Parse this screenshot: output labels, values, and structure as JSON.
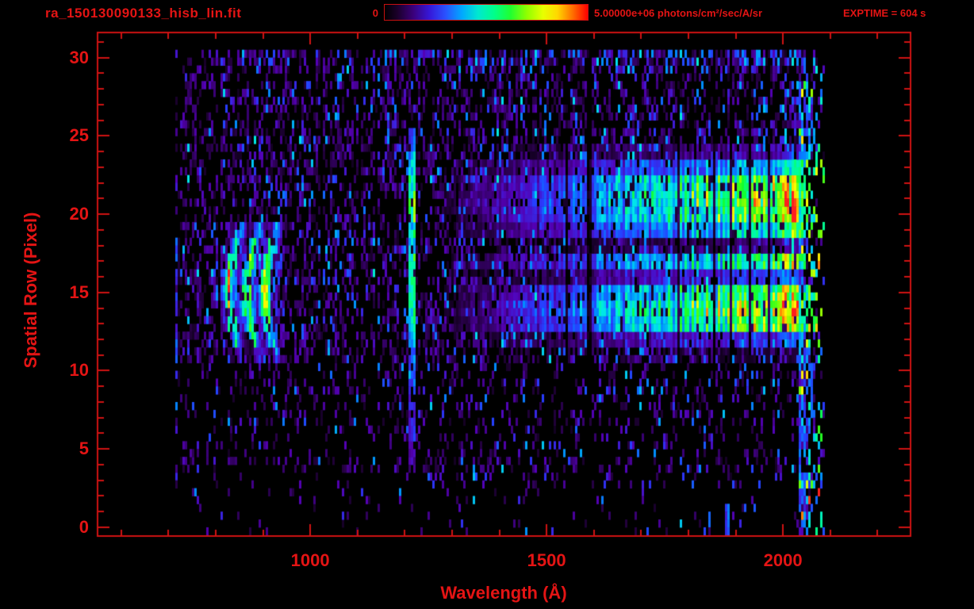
{
  "window": {
    "background": "#000000"
  },
  "header": {
    "title": "ra_150130090133_hisb_lin.fit",
    "exptime_label": "EXPTIME = 604 s"
  },
  "colors": {
    "accent_red": "#e41414",
    "axis_red": "#d01212",
    "colorbar_stops": [
      [
        0,
        "#000000"
      ],
      [
        6,
        "#1a0028"
      ],
      [
        14,
        "#3a007a"
      ],
      [
        22,
        "#3617d8"
      ],
      [
        30,
        "#2a52ff"
      ],
      [
        38,
        "#00a8ff"
      ],
      [
        46,
        "#00e8d0"
      ],
      [
        54,
        "#00ff8a"
      ],
      [
        62,
        "#20ff30"
      ],
      [
        70,
        "#90ff00"
      ],
      [
        78,
        "#e8ff00"
      ],
      [
        85,
        "#ffd800"
      ],
      [
        92,
        "#ff7700"
      ],
      [
        100,
        "#ff0000"
      ]
    ],
    "heatmap_stops": [
      [
        0.0,
        0,
        0,
        0
      ],
      [
        0.07,
        36,
        0,
        64
      ],
      [
        0.16,
        84,
        0,
        180
      ],
      [
        0.26,
        40,
        60,
        255
      ],
      [
        0.36,
        0,
        140,
        255
      ],
      [
        0.46,
        0,
        230,
        235
      ],
      [
        0.55,
        0,
        255,
        150
      ],
      [
        0.65,
        20,
        255,
        40
      ],
      [
        0.74,
        140,
        255,
        0
      ],
      [
        0.82,
        255,
        255,
        0
      ],
      [
        0.9,
        255,
        150,
        0
      ],
      [
        1.0,
        255,
        30,
        30
      ]
    ]
  },
  "chart_data": {
    "type": "heatmap",
    "title": "ra_150130090133_hisb_lin.fit",
    "xlabel": "Wavelength (Å)",
    "ylabel": "Spatial Row (Pixel)",
    "xlim": [
      550,
      2270
    ],
    "ylim": [
      -0.56,
      31.6
    ],
    "xticks": {
      "major": [
        {
          "value": 1000,
          "label": "1000"
        },
        {
          "value": 1500,
          "label": "1500"
        },
        {
          "value": 2000,
          "label": "2000"
        }
      ],
      "minor_step": 100
    },
    "yticks": {
      "major": [
        {
          "value": 0,
          "label": "0"
        },
        {
          "value": 5,
          "label": "5"
        },
        {
          "value": 10,
          "label": "10"
        },
        {
          "value": 15,
          "label": "15"
        },
        {
          "value": 20,
          "label": "20"
        },
        {
          "value": 25,
          "label": "25"
        },
        {
          "value": 30,
          "label": "30"
        }
      ],
      "minor_step": 1
    },
    "colorbar": {
      "min": 0,
      "max": 5000000,
      "min_label": "0",
      "max_label": "5.00000e+06 photons/cm²/sec/A/sr",
      "units": "photons/cm²/sec/A/sr"
    },
    "exposure": {
      "label": "EXPTIME = 604 s",
      "seconds": 604
    },
    "data_extent": {
      "wavelength_min": 715,
      "wavelength_max": 2085,
      "row_min": 0,
      "row_max": 30.5
    },
    "continuum": {
      "onset_wavelength": 1245,
      "mid_wavelength": 1650,
      "bright_wavelength": 2035
    },
    "row_continuum_profile": [
      0,
      0,
      0,
      0,
      0,
      0,
      0,
      0,
      0,
      0,
      0,
      0.06,
      0.3,
      0.85,
      0.95,
      0.8,
      0.32,
      0.72,
      0.14,
      0.62,
      0.85,
      0.92,
      0.85,
      0.5,
      0.18,
      0,
      0,
      0,
      0,
      0,
      0
    ],
    "noise_density_by_row": [
      0.05,
      0.06,
      0.07,
      0.12,
      0.3,
      0.22,
      0.22,
      0.26,
      0.22,
      0.28,
      0.24,
      0.5,
      0.55,
      0.5,
      0.45,
      0.5,
      0.5,
      0.5,
      0.55,
      0.5,
      0.45,
      0.45,
      0.5,
      0.55,
      0.55,
      0.5,
      0.4,
      0.45,
      0.4,
      0.45,
      0.55
    ],
    "blue_ramp_by_row": [
      0.5,
      0.5,
      0.45,
      0.45,
      0.2,
      0.2,
      0.2,
      0.2,
      0.2,
      0.25,
      0.25,
      0.4,
      0.45,
      0.3,
      0.3,
      0.3,
      0.35,
      0.3,
      0.45,
      0.35,
      0.3,
      0.3,
      0.35,
      0.45,
      0.5,
      0.5,
      0.45,
      0.5,
      0.5,
      0.6,
      1.0
    ],
    "features": [
      {
        "name": "lyman_alpha_emission_line",
        "wavelength": 1216,
        "row_min": 4,
        "row_max": 25,
        "strength_by_row": [
          0,
          0,
          0,
          0,
          0.12,
          0.18,
          0.24,
          0.2,
          0.24,
          0.3,
          0.3,
          0.32,
          0.4,
          0.5,
          0.56,
          0.64,
          0.68,
          0.62,
          0.46,
          0.52,
          0.62,
          0.68,
          0.62,
          0.5,
          0.4,
          0.28,
          0,
          0,
          0,
          0,
          0
        ]
      },
      {
        "name": "curved_airglow_arcs",
        "centers": [
          828,
          866,
          904
        ],
        "width": 14,
        "curvature": 1.6,
        "row_min": 11,
        "row_max": 19,
        "amplitude_by_row": [
          0,
          0,
          0,
          0,
          0,
          0,
          0,
          0,
          0,
          0,
          0,
          0.2,
          0.45,
          0.6,
          0.72,
          0.76,
          0.72,
          0.66,
          0.5,
          0.32,
          0,
          0,
          0,
          0,
          0,
          0,
          0,
          0,
          0,
          0,
          0
        ]
      },
      {
        "name": "right_edge_speckle",
        "wavelength_min": 2035,
        "wavelength_max": 2085
      },
      {
        "name": "blue_mark_bottom",
        "wavelength": 1882,
        "row_min": 0,
        "row_max": 1.3
      },
      {
        "name": "left_edge_line",
        "wavelength": 721,
        "row_min": 6,
        "row_max": 18
      }
    ],
    "seed": 42
  }
}
